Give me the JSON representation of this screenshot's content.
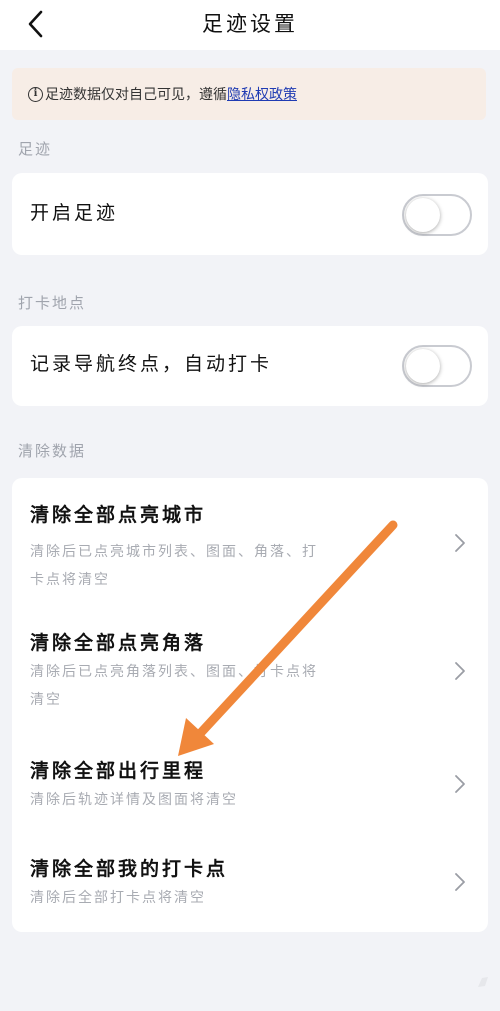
{
  "header": {
    "title": "足迹设置",
    "back_icon": "back-arrow-icon"
  },
  "notice": {
    "icon": "info-icon",
    "text": "足迹数据仅对自己可见，遵循",
    "link": "隐私权政策"
  },
  "sections": {
    "footprint": {
      "label": "足迹",
      "toggle_label": "开启足迹",
      "toggle_on": false
    },
    "checkin": {
      "label": "打卡地点",
      "toggle_label": "记录导航终点，自动打卡",
      "toggle_on": false
    },
    "clear": {
      "label": "清除数据",
      "items": [
        {
          "title": "清除全部点亮城市",
          "desc": "清除后已点亮城市列表、图面、角落、打卡点将清空"
        },
        {
          "title": "清除全部点亮角落",
          "desc": "清除后已点亮角落列表、图面、打卡点将清空"
        },
        {
          "title": "清除全部出行里程",
          "desc": "清除后轨迹详情及图面将清空"
        },
        {
          "title": "清除全部我的打卡点",
          "desc": "清除后全部打卡点将清空"
        }
      ]
    }
  },
  "colors": {
    "background": "#f2f3f7",
    "notice_bg": "#f7ede6",
    "link": "#1f3bb3",
    "annotation_arrow": "#f0873a"
  }
}
